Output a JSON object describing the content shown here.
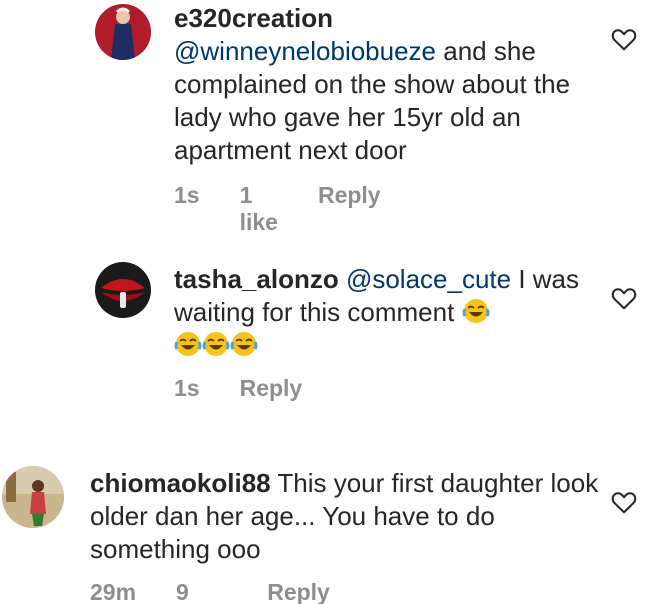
{
  "comments": [
    {
      "username": "e320creation",
      "mention": "@winneynelobiobueze",
      "text": " and she complained on the show about the lady who gave her 15yr old an apartment next door",
      "time": "1s",
      "likes": "1 like",
      "reply": "Reply"
    },
    {
      "username": "tasha_alonzo",
      "mention": "@solace_cute",
      "text": " I was waiting for this comment",
      "emoji_name": "face-with-tears-of-joy-icon",
      "time": "1s",
      "reply": "Reply"
    },
    {
      "username": "chiomaokoli88",
      "text": " This your first daughter look older dan her age... You have to do something  ooo",
      "time": "29m",
      "likes": "9 likes",
      "reply": "Reply"
    }
  ],
  "colors": {
    "text": "#262626",
    "meta": "#8e8e8e",
    "mention": "#00376b"
  }
}
